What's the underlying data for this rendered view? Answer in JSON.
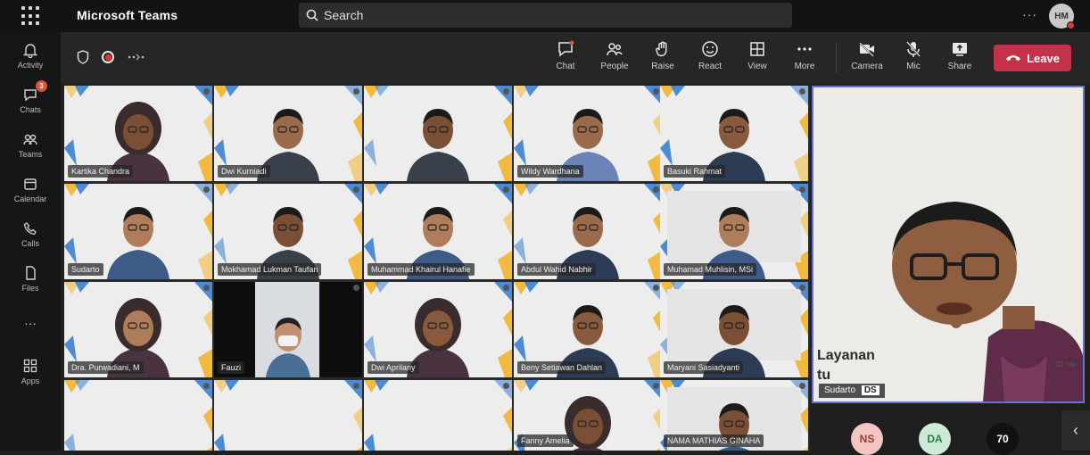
{
  "topbar": {
    "app_title": "Microsoft Teams",
    "search_placeholder": "Search",
    "more": "···",
    "user_initials": "HM"
  },
  "rail": {
    "items": [
      {
        "label": "Activity",
        "icon": "bell-icon"
      },
      {
        "label": "Chats",
        "icon": "chat-icon",
        "badge": "3"
      },
      {
        "label": "Teams",
        "icon": "teams-icon"
      },
      {
        "label": "Calendar",
        "icon": "calendar-icon"
      },
      {
        "label": "Calls",
        "icon": "phone-icon"
      },
      {
        "label": "Files",
        "icon": "file-icon"
      },
      {
        "label": "···",
        "icon": "more-icon"
      },
      {
        "label": "Apps",
        "icon": "apps-icon"
      }
    ]
  },
  "toolbar": {
    "buttons": [
      {
        "label": "Chat",
        "icon": "chat-icon"
      },
      {
        "label": "People",
        "icon": "people-icon"
      },
      {
        "label": "Raise",
        "icon": "hand-icon"
      },
      {
        "label": "React",
        "icon": "smile-icon"
      },
      {
        "label": "View",
        "icon": "grid-icon"
      },
      {
        "label": "More",
        "icon": "more-icon"
      },
      {
        "label": "Camera",
        "icon": "camera-off-icon"
      },
      {
        "label": "Mic",
        "icon": "mic-off-icon"
      },
      {
        "label": "Share",
        "icon": "share-icon"
      }
    ],
    "leave_label": "Leave"
  },
  "participants": [
    "Kartika Chandra",
    "Dwi Kurniadi",
    "",
    "Wildy Wardhana",
    "Basuki Rahmat",
    "Abdul Wahid Nabhir",
    "Muhamad Muhlisin, MSi",
    "Sudarto",
    "Mokhamad Lukman Taufan",
    "Muhammad Khairul Hanafie",
    "Beny Setiawan Dahlan",
    "Maryani Sasiadyanti",
    "Dra. Purwadiani, M",
    "Fauzi",
    "Dwi Aprilany",
    "Fanny Amelia",
    "NAMA MATHIAS GINAHA"
  ],
  "spotlight": {
    "name": "Sudarto",
    "name_badge": "DS",
    "overlay_text": "Layanan",
    "overlay_text2": "tu",
    "date": "22 Ma"
  },
  "bottom_avatars": [
    {
      "initials": "NS",
      "bg": "#f3c6c2",
      "fg": "#a13a2f"
    },
    {
      "initials": "DA",
      "bg": "#cde9d7",
      "fg": "#2f7a49"
    },
    {
      "initials": "70",
      "bg": "#111111",
      "fg": "#ffffff"
    }
  ],
  "colors": {
    "leave": "#c4314b",
    "accent": "#6b70d4",
    "badge": "#d4563e"
  }
}
